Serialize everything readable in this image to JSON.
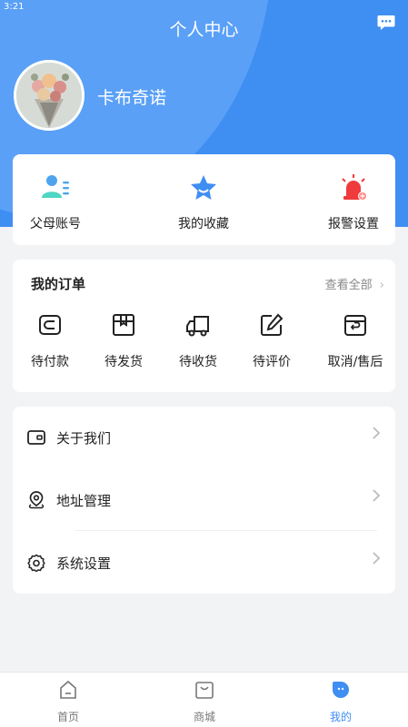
{
  "status": {
    "time": "3:21"
  },
  "header": {
    "title": "个人中心",
    "username": "卡布奇诺"
  },
  "quick_actions": [
    {
      "label": "父母账号",
      "icon": "parent-account-icon"
    },
    {
      "label": "我的收藏",
      "icon": "star-icon"
    },
    {
      "label": "报警设置",
      "icon": "alarm-light-icon"
    }
  ],
  "orders": {
    "title": "我的订单",
    "view_all": "查看全部",
    "items": [
      {
        "label": "待付款",
        "icon": "wallet-icon"
      },
      {
        "label": "待发货",
        "icon": "box-icon"
      },
      {
        "label": "待收货",
        "icon": "truck-icon"
      },
      {
        "label": "待评价",
        "icon": "edit-icon"
      },
      {
        "label": "取消/售后",
        "icon": "return-icon"
      }
    ]
  },
  "menu": [
    {
      "label": "关于我们",
      "icon": "wallet-icon"
    },
    {
      "label": "地址管理",
      "icon": "location-icon"
    },
    {
      "label": "系统设置",
      "icon": "gear-icon"
    }
  ],
  "tabs": [
    {
      "label": "首页",
      "icon": "home-icon"
    },
    {
      "label": "商城",
      "icon": "shop-icon"
    },
    {
      "label": "我的",
      "icon": "profile-icon"
    }
  ],
  "colors": {
    "primary": "#3f8ef2",
    "alarm": "#ef3b3b",
    "quick_icon": "#4fa3ef"
  }
}
